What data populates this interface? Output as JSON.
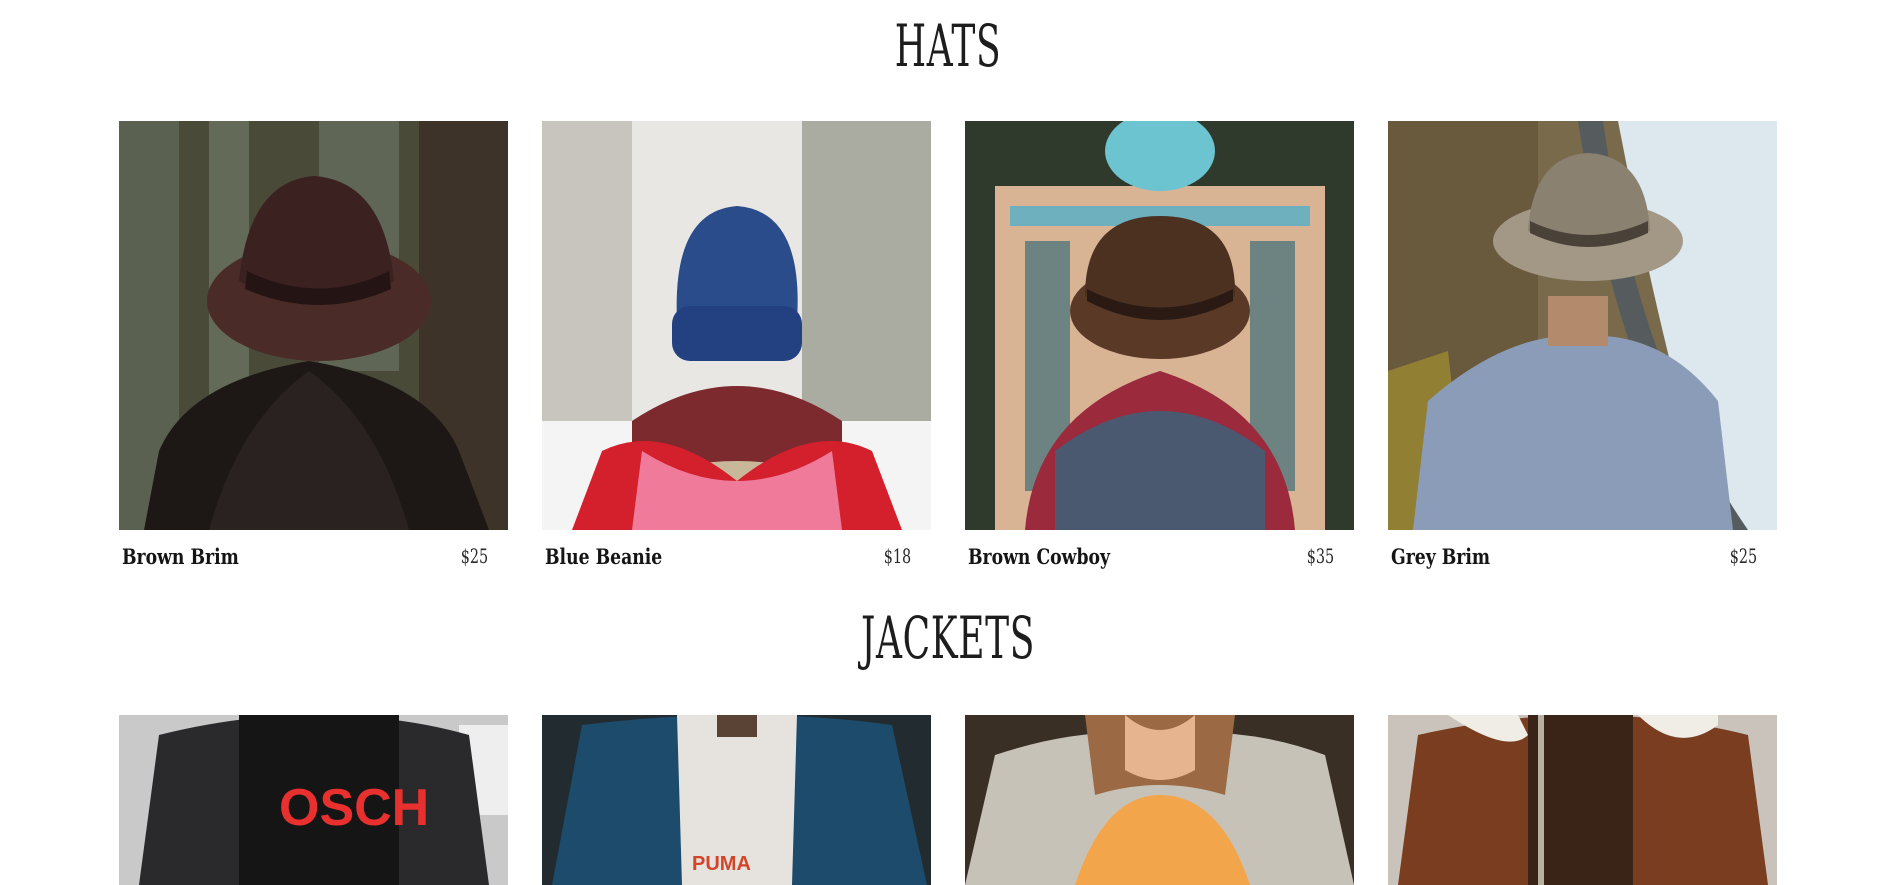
{
  "sections": {
    "hats": {
      "title": "HATS",
      "items": [
        {
          "name": "Brown Brim",
          "price": "$25",
          "image": "woman-brown-fedora-forest"
        },
        {
          "name": "Blue Beanie",
          "price": "$18",
          "image": "blue-beanie-snow"
        },
        {
          "name": "Brown Cowboy",
          "price": "$35",
          "image": "brown-cowboy-hat-mosque"
        },
        {
          "name": "Grey Brim",
          "price": "$25",
          "image": "grey-brim-coastal-road"
        }
      ]
    },
    "jackets": {
      "title": "JACKETS",
      "items": [
        {
          "image": "black-denim-jacket-red-print"
        },
        {
          "image": "blue-denim-jacket-puma-tee"
        },
        {
          "image": "light-denim-jacket-orange-tee"
        },
        {
          "image": "brown-suede-shearling-jacket"
        }
      ]
    }
  }
}
